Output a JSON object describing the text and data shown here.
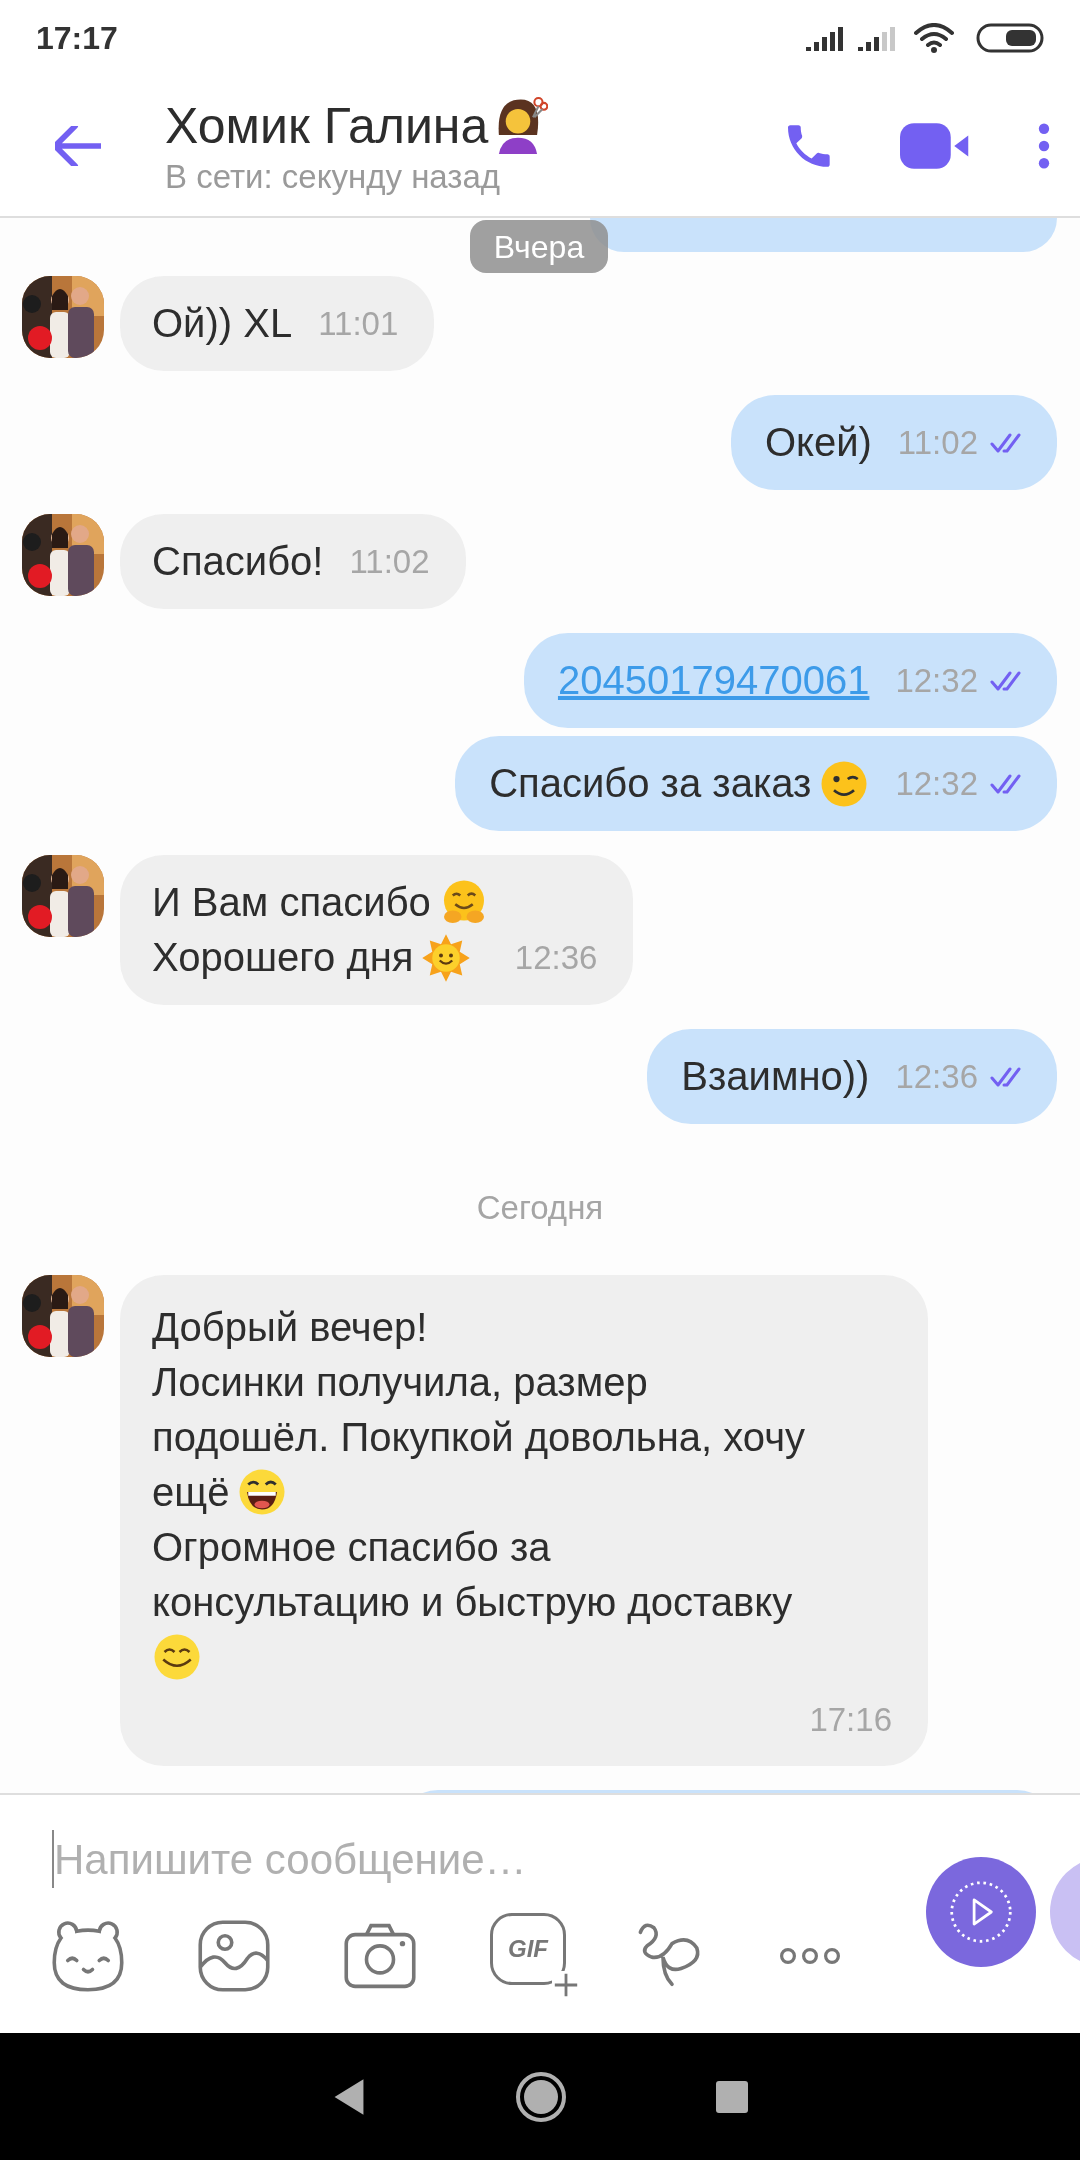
{
  "status_bar": {
    "time": "17:17"
  },
  "header": {
    "name": "Хомик Галина",
    "subtitle": "В сети: секунду назад"
  },
  "floating_date": "Вчера",
  "messages": [
    {
      "kind": "partial_outgoing"
    },
    {
      "kind": "incoming",
      "lines": [
        [
          {
            "kind": "text",
            "text": "Ой)) XL"
          }
        ]
      ],
      "time": "11:01"
    },
    {
      "kind": "outgoing",
      "lines": [
        [
          {
            "kind": "text",
            "text": "Окей)"
          }
        ]
      ],
      "time": "11:02",
      "read": true
    },
    {
      "kind": "incoming",
      "lines": [
        [
          {
            "kind": "text",
            "text": "Спасибо!"
          }
        ]
      ],
      "time": "11:02"
    },
    {
      "kind": "outgoing",
      "lines": [
        [
          {
            "kind": "link",
            "text": "20450179470061"
          }
        ]
      ],
      "time": "12:32",
      "read": true
    },
    {
      "kind": "outgoing",
      "lines": [
        [
          {
            "kind": "text",
            "text": "Спасибо за заказ"
          },
          {
            "kind": "winking"
          }
        ]
      ],
      "time": "12:32",
      "read": true
    },
    {
      "kind": "incoming",
      "lines": [
        [
          {
            "kind": "text",
            "text": "И Вам спасибо"
          },
          {
            "kind": "hugging"
          }
        ],
        [
          {
            "kind": "text",
            "text": "Хорошего дня"
          },
          {
            "kind": "sun"
          }
        ]
      ],
      "time": "12:36"
    },
    {
      "kind": "outgoing",
      "lines": [
        [
          {
            "kind": "text",
            "text": "Взаимно))"
          }
        ]
      ],
      "time": "12:36",
      "read": true
    },
    {
      "kind": "date",
      "text": "Сегодня"
    },
    {
      "kind": "incoming",
      "lines": [
        [
          {
            "kind": "text",
            "text": "Добрый вечер!"
          }
        ],
        [
          {
            "kind": "text",
            "text": "Лосинки получила, размер"
          }
        ],
        [
          {
            "kind": "text",
            "text": "подошёл. Покупкой довольна, хочу"
          }
        ],
        [
          {
            "kind": "text",
            "text": "ещё"
          },
          {
            "kind": "laughing"
          }
        ],
        [
          {
            "kind": "text",
            "text": "Огромное спасибо за"
          }
        ],
        [
          {
            "kind": "text",
            "text": "консультацию и быструю доставку"
          }
        ],
        [
          {
            "kind": "smiling"
          }
        ]
      ],
      "time": "17:16"
    },
    {
      "kind": "partial_outgoing"
    }
  ],
  "composer": {
    "placeholder": "Напишите сообщение…",
    "gif_label": "GIF"
  }
}
